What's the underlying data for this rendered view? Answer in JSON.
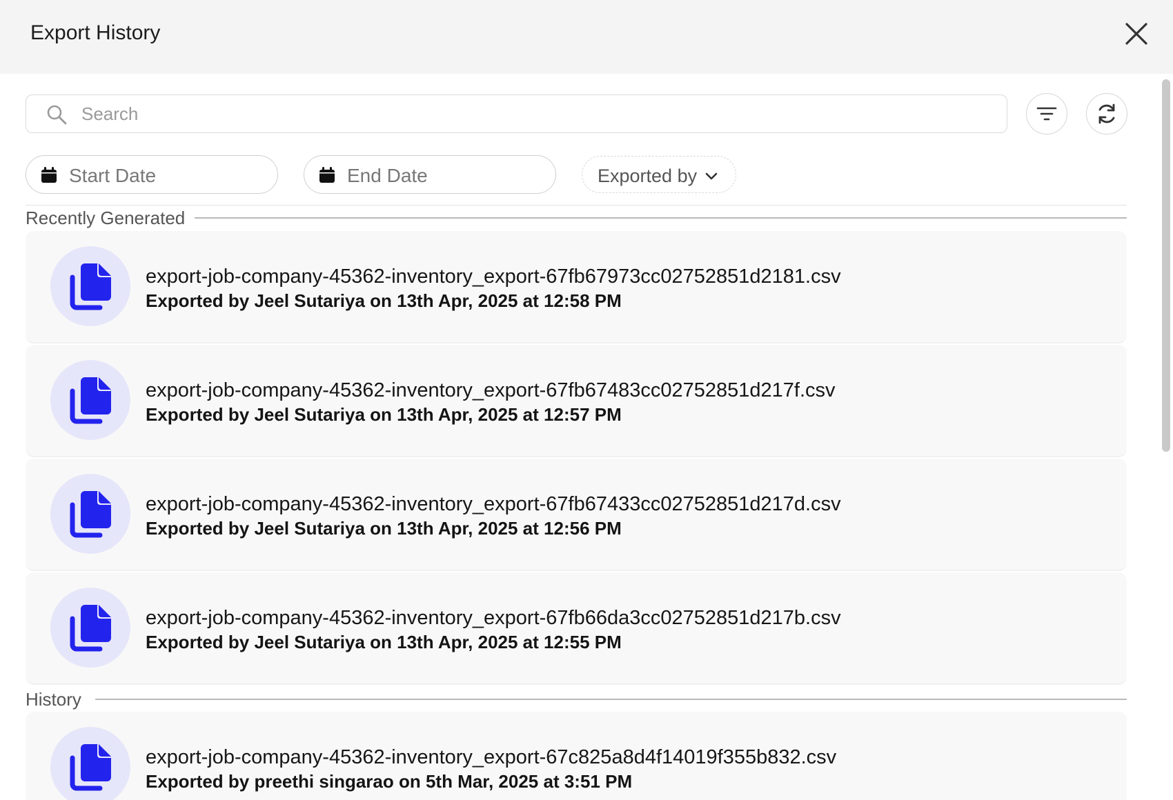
{
  "header": {
    "title": "Export History"
  },
  "search": {
    "placeholder": "Search"
  },
  "filters": {
    "start_date_label": "Start Date",
    "end_date_label": "End Date",
    "exported_by_label": "Exported by"
  },
  "sections": {
    "recent_label": "Recently Generated",
    "history_label": "History"
  },
  "recent": [
    {
      "file": "export-job-company-45362-inventory_export-67fb67973cc02752851d2181.csv",
      "meta": "Exported by Jeel Sutariya on 13th Apr, 2025 at 12:58 PM"
    },
    {
      "file": "export-job-company-45362-inventory_export-67fb67483cc02752851d217f.csv",
      "meta": "Exported by Jeel Sutariya on 13th Apr, 2025 at 12:57 PM"
    },
    {
      "file": "export-job-company-45362-inventory_export-67fb67433cc02752851d217d.csv",
      "meta": "Exported by Jeel Sutariya on 13th Apr, 2025 at 12:56 PM"
    },
    {
      "file": "export-job-company-45362-inventory_export-67fb66da3cc02752851d217b.csv",
      "meta": "Exported by Jeel Sutariya on 13th Apr, 2025 at 12:55 PM"
    }
  ],
  "history": [
    {
      "file": "export-job-company-45362-inventory_export-67c825a8d4f14019f355b832.csv",
      "meta": "Exported by preethi singarao on 5th Mar, 2025 at 3:51 PM"
    }
  ],
  "icons": {
    "file": "file-copy-icon",
    "search": "search-icon",
    "filter": "filter-icon",
    "refresh": "refresh-icon",
    "calendar": "calendar-icon",
    "close": "close-icon",
    "chevron": "chevron-down-icon"
  },
  "colors": {
    "accent": "#2323ee",
    "badge": "#e6e6fa"
  }
}
